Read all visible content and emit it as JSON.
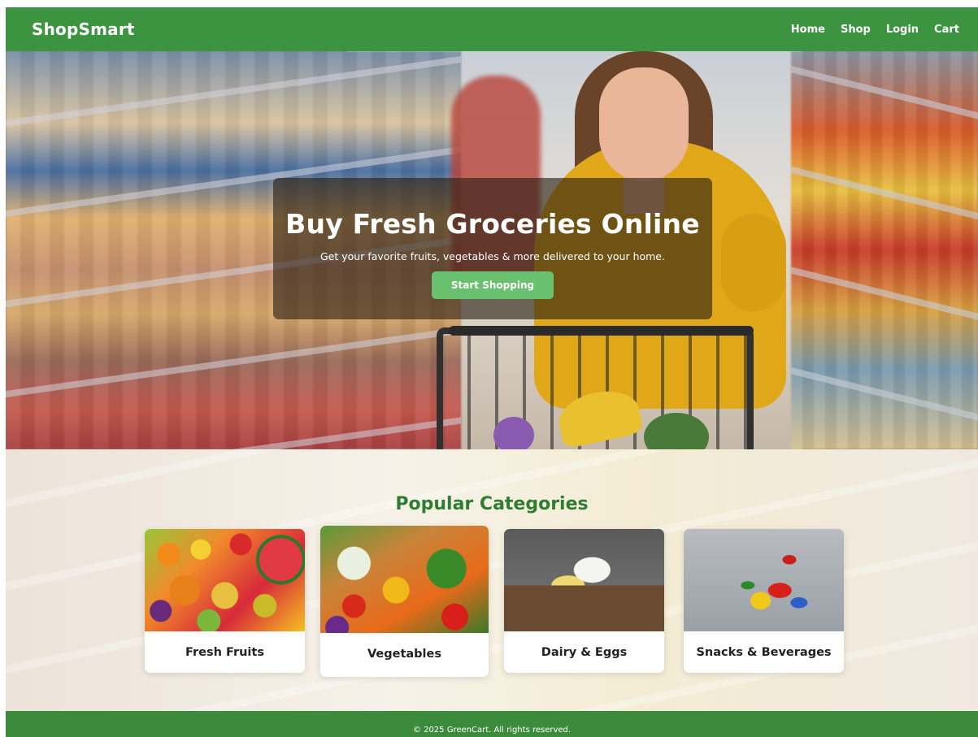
{
  "navbar": {
    "brand": "ShopSmart",
    "links": [
      "Home",
      "Shop",
      "Login",
      "Cart"
    ]
  },
  "hero": {
    "title": "Buy Fresh Groceries Online",
    "subtitle": "Get your favorite fruits, vegetables & more delivered to your home.",
    "cta_label": "Start Shopping"
  },
  "categories": {
    "title": "Popular Categories",
    "items": [
      {
        "label": "Fresh Fruits"
      },
      {
        "label": "Vegetables"
      },
      {
        "label": "Dairy & Eggs"
      },
      {
        "label": "Snacks & Beverages"
      }
    ]
  },
  "footer": {
    "text": "© 2025 GreenCart. All rights reserved."
  },
  "colors": {
    "primary_green": "#3c9440",
    "heading_green": "#2e7d32",
    "button_green": "#69c06e"
  }
}
